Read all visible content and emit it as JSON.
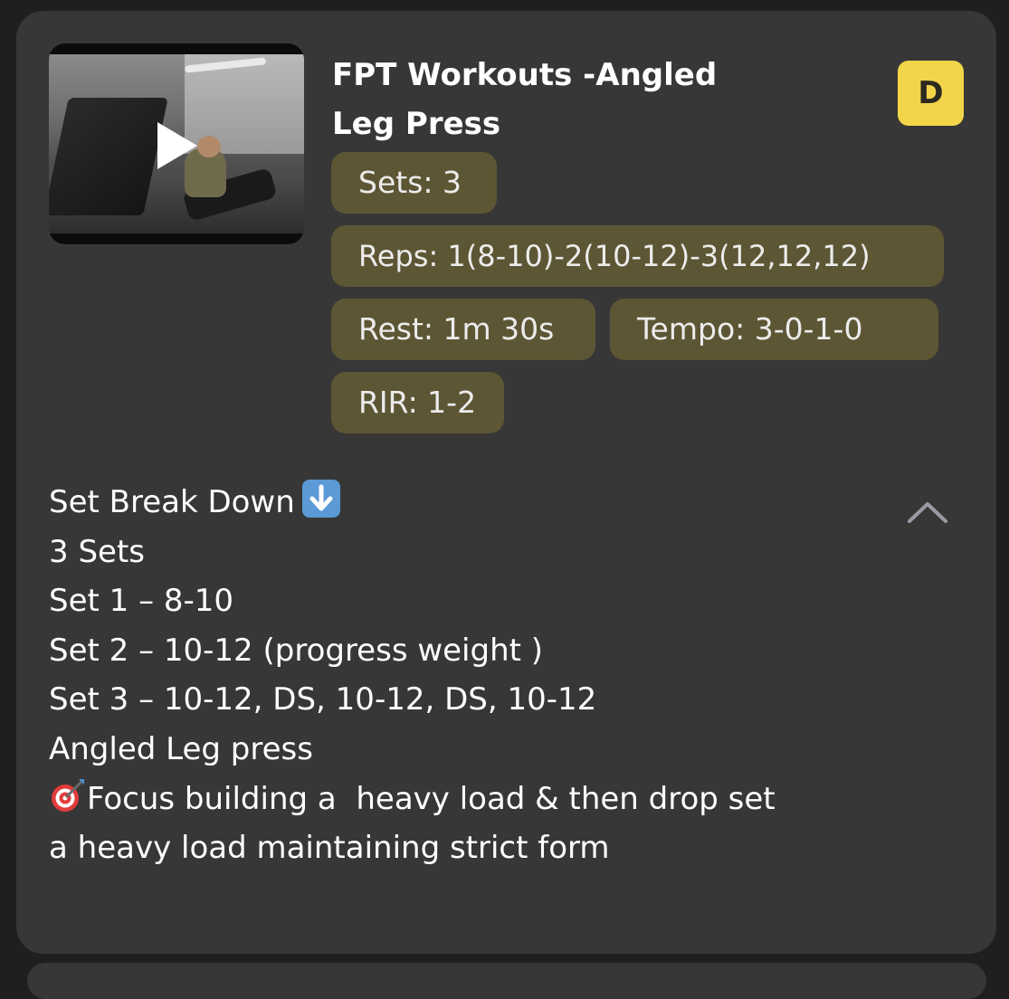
{
  "card": {
    "title": "FPT Workouts -Angled Leg Press",
    "avatar_initial": "D",
    "video_thumbnail": {
      "icon": "play-icon"
    },
    "tags": {
      "sets": "Sets: 3",
      "reps": "Reps: 1(8-10)-2(10-12)-3(12,12,12)",
      "rest": "Rest: 1m 30s",
      "tempo": "Tempo: 3-0-1-0",
      "rir": "RIR: 1-2"
    },
    "description": {
      "header": "Set Break Down",
      "header_icon": "down-arrow-icon",
      "lines": [
        "3 Sets",
        "Set 1 – 8-10",
        "Set 2 – 10-12 (progress weight )",
        "Set 3 – 10-12, DS, 10-12, DS, 10-12",
        "",
        "Angled Leg press"
      ],
      "focus_icon": "target-dart-icon",
      "focus_line_1": "Focus building a  heavy load & then drop set",
      "focus_line_2": "a heavy load maintaining strict form"
    },
    "collapse_icon": "chevron-up-icon"
  },
  "colors": {
    "background": "#1f1f1f",
    "card": "#373737",
    "pill": "#5d5634",
    "avatar": "#f3d54a",
    "chevron": "#9a9aa6"
  }
}
